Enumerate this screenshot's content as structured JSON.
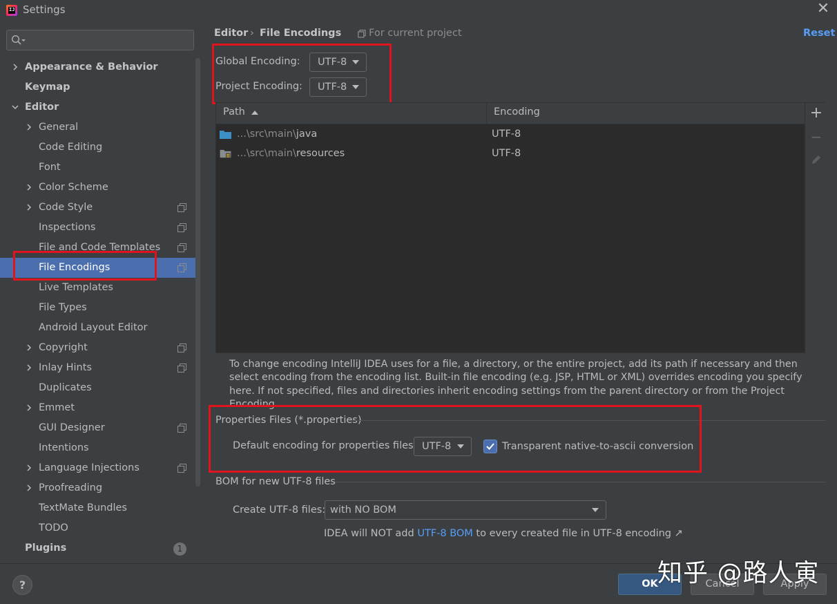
{
  "window": {
    "title": "Settings",
    "close_icon": "✕"
  },
  "sidebar": {
    "search_placeholder": "",
    "items": [
      {
        "label": "Appearance & Behavior",
        "expandable": true
      },
      {
        "label": "Keymap"
      },
      {
        "label": "Editor",
        "expanded": true
      },
      {
        "label": "General",
        "expandable": true
      },
      {
        "label": "Code Editing"
      },
      {
        "label": "Font"
      },
      {
        "label": "Color Scheme",
        "expandable": true
      },
      {
        "label": "Code Style",
        "expandable": true,
        "project_scoped": true
      },
      {
        "label": "Inspections",
        "project_scoped": true
      },
      {
        "label": "File and Code Templates",
        "project_scoped": true
      },
      {
        "label": "File Encodings",
        "project_scoped": true,
        "selected": true
      },
      {
        "label": "Live Templates"
      },
      {
        "label": "File Types"
      },
      {
        "label": "Android Layout Editor"
      },
      {
        "label": "Copyright",
        "expandable": true,
        "project_scoped": true
      },
      {
        "label": "Inlay Hints",
        "expandable": true,
        "project_scoped": true
      },
      {
        "label": "Duplicates"
      },
      {
        "label": "Emmet",
        "expandable": true
      },
      {
        "label": "GUI Designer",
        "project_scoped": true
      },
      {
        "label": "Intentions"
      },
      {
        "label": "Language Injections",
        "expandable": true,
        "project_scoped": true
      },
      {
        "label": "Proofreading",
        "expandable": true
      },
      {
        "label": "TextMate Bundles"
      },
      {
        "label": "TODO"
      },
      {
        "label": "Plugins",
        "badge": "1"
      }
    ]
  },
  "header": {
    "breadcrumb_parent": "Editor",
    "breadcrumb_separator": "›",
    "breadcrumb_current": "File Encodings",
    "scope_note": "For current project",
    "reset_label": "Reset"
  },
  "encodings": {
    "global_label": "Global Encoding:",
    "global_value": "UTF-8",
    "project_label": "Project Encoding:",
    "project_value": "UTF-8"
  },
  "table": {
    "columns": [
      "Path",
      "Encoding"
    ],
    "sort_column": "Path",
    "sort_direction": "ascending",
    "rows": [
      {
        "path_prefix": "...\\src\\main\\",
        "path_name": "java",
        "encoding": "UTF-8",
        "icon": "source-folder-icon"
      },
      {
        "path_prefix": "...\\src\\main\\",
        "path_name": "resources",
        "encoding": "UTF-8",
        "icon": "resources-folder-icon"
      }
    ],
    "toolbar": {
      "add": "+",
      "remove": "−",
      "edit": "edit-icon"
    }
  },
  "help_text": "To change encoding IntelliJ IDEA uses for a file, a directory, or the entire project, add its path if necessary and then select encoding from the encoding list. Built-in file encoding (e.g. JSP, HTML or XML) overrides encoding you specify here. If not specified, files and directories inherit encoding settings from the parent directory or from the Project Encoding.",
  "properties": {
    "section_title": "Properties Files (*.properties)",
    "default_label": "Default encoding for properties files:",
    "default_value": "UTF-8",
    "native_to_ascii_label": "Transparent native-to-ascii conversion",
    "native_to_ascii_checked": true
  },
  "bom": {
    "section_title": "BOM for new UTF-8 files",
    "create_label": "Create UTF-8 files:",
    "create_value": "with NO BOM",
    "hint_before": "IDEA will NOT add ",
    "hint_link": "UTF-8 BOM",
    "hint_after": " to every created file in UTF-8 encoding ↗"
  },
  "footer": {
    "help_label": "?",
    "ok_label": "OK",
    "cancel_label": "Cancel",
    "apply_label": "Apply"
  },
  "watermark": "知乎 @路人寅",
  "colors": {
    "background": "#3c3f41",
    "selection": "#4b6eaf",
    "link": "#589df6",
    "highlight_box": "#e0141d"
  }
}
